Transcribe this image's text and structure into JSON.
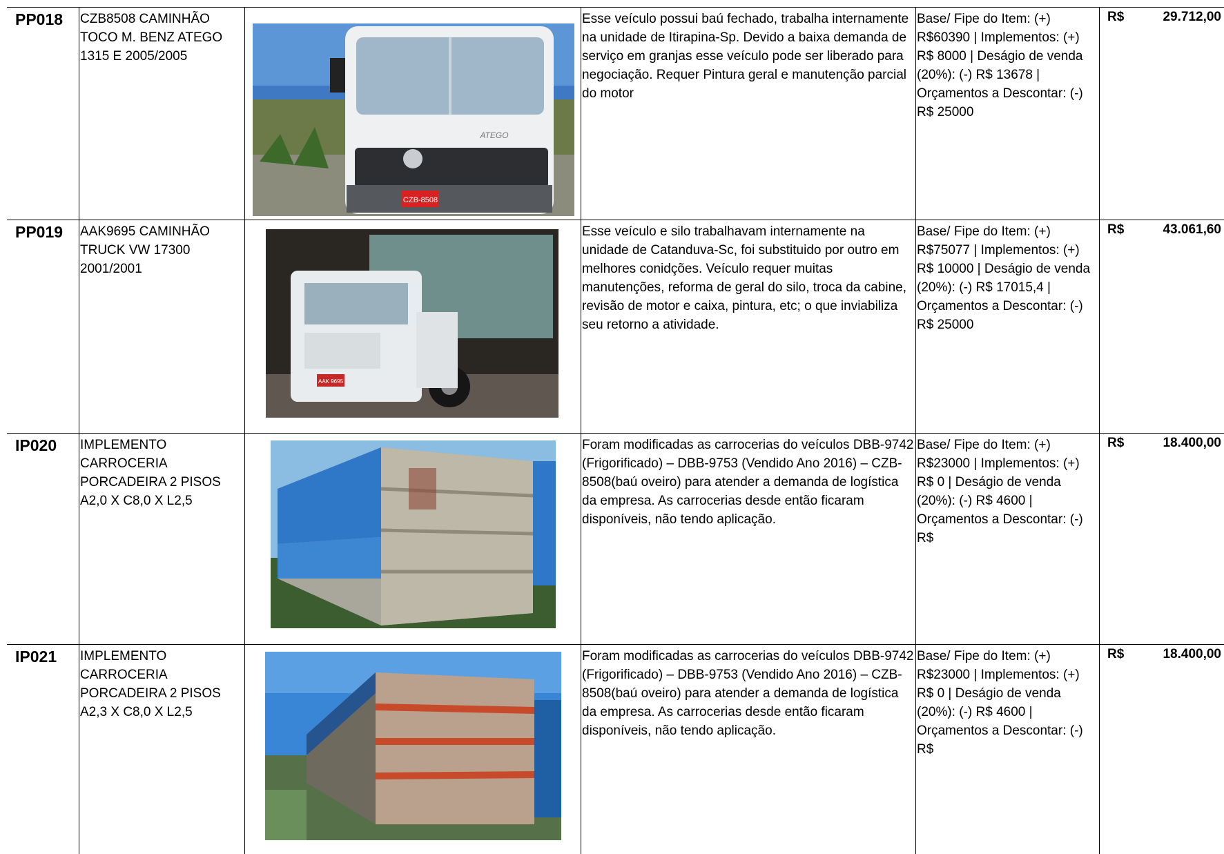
{
  "items": [
    {
      "code": "PP018",
      "description": "CZB8508 CAMINHÃO TOCO M. BENZ ATEGO 1315 E 2005/2005",
      "photo": "white-mercedes-truck-cab",
      "plate": "CZB-8508",
      "badge": "ATEGO",
      "justification": "Esse veículo possui baú fechado, trabalha internamente na unidade de Itirapina-Sp. Devido a baixa demanda de serviço em granjas esse veículo pode ser liberado para negociação.  Requer Pintura geral e manutenção parcial do motor",
      "calculation": "Base/ Fipe do Item: (+) R$60390 | Implementos: (+) R$ 8000 | Deságio de venda (20%): (-) R$ 13678 | Orçamentos a Descontar: (-) R$ 25000",
      "currency": "R$",
      "value": "29.712,00"
    },
    {
      "code": "PP019",
      "description": "AAK9695 CAMINHÃO TRUCK VW 17300 2001/2001",
      "photo": "white-vw-truck-with-silo",
      "plate": "AAK 9695",
      "justification": "Esse veículo e silo trabalhavam internamente na unidade de Catanduva-Sc, foi substituido por outro em melhores conidções. Veículo requer muitas manutenções, reforma de geral do silo, troca da cabine, revisão de motor e caixa,  pintura, etc; o que inviabiliza seu retorno a atividade.",
      "calculation": "Base/ Fipe do Item: (+) R$75077 | Implementos: (+) R$ 10000 | Deságio de venda (20%): (-) R$ 17015,4 | Orçamentos a Descontar: (-) R$ 25000",
      "currency": "R$",
      "value": "43.061,60"
    },
    {
      "code": "IP020",
      "description": "IMPLEMENTO CARROCERIA PORCADEIRA 2 PISOS A2,0 X C8,0 X L2,5",
      "photo": "livestock-truck-body-blue-tarp",
      "justification": "Foram modificadas as carrocerias do veículos DBB-9742 (Frigorificado) – DBB-9753 (Vendido Ano 2016) – CZB-8508(baú oveiro) para atender a demanda de logística da empresa. As carrocerias desde então ficaram disponíveis, não tendo aplicação.",
      "calculation": "Base/ Fipe do Item: (+) R$23000 | Implementos: (+) R$ 0 | Deságio de venda (20%): (-) R$ 4600 | Orçamentos a Descontar: (-) R$",
      "currency": "R$",
      "value": "18.400,00"
    },
    {
      "code": "IP021",
      "description": "IMPLEMENTO CARROCERIA PORCADEIRA 2 PISOS A2,3 X C8,0 X L2,5",
      "photo": "livestock-truck-body-orange-rust",
      "justification": "Foram modificadas as carrocerias do veículos DBB-9742 (Frigorificado) – DBB-9753 (Vendido Ano 2016) – CZB-8508(baú oveiro) para atender a demanda de logística da empresa. As carrocerias desde então ficaram disponíveis, não tendo aplicação.",
      "calculation": "Base/ Fipe do Item: (+) R$23000 | Implementos: (+) R$ 0 | Deságio de venda (20%): (-) R$ 4600 | Orçamentos a Descontar: (-) R$",
      "currency": "R$",
      "value": "18.400,00"
    }
  ]
}
